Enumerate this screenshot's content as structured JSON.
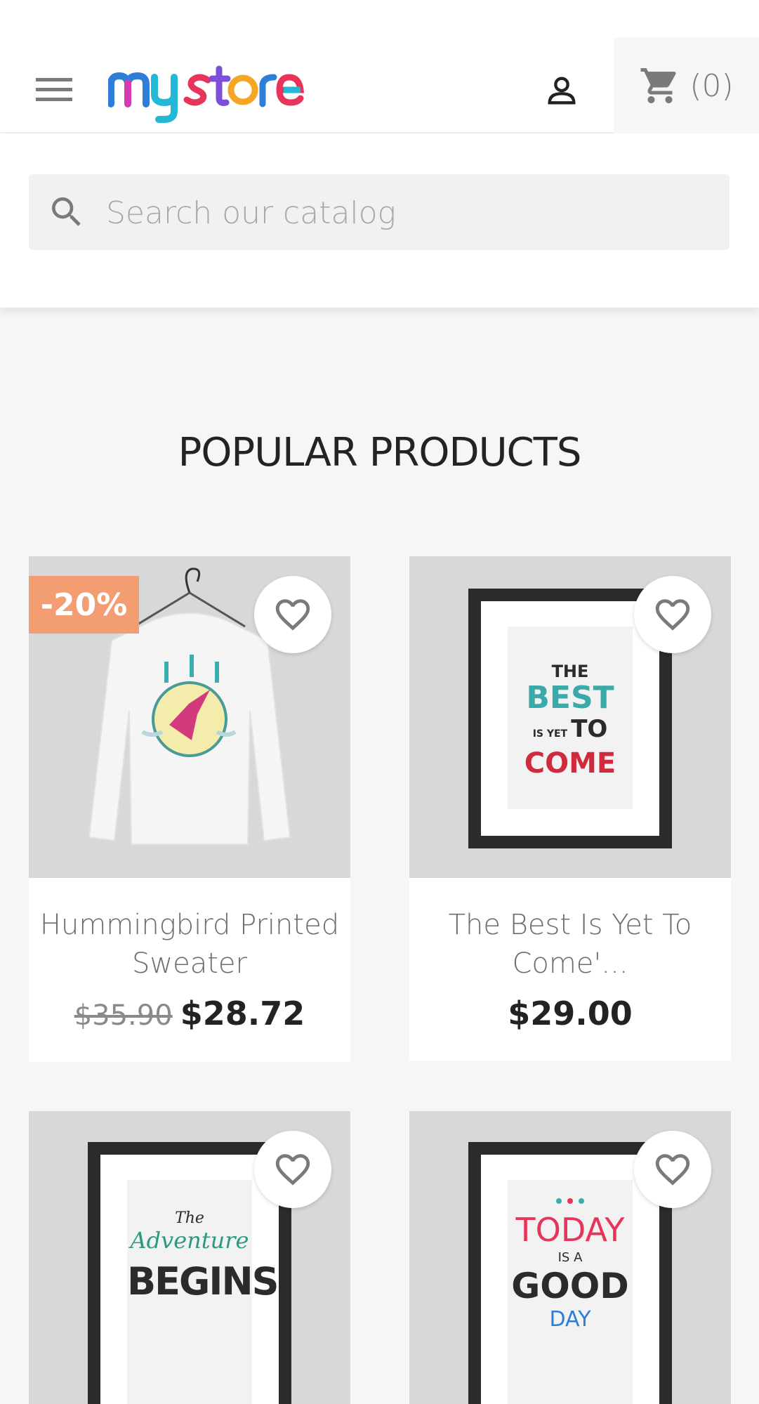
{
  "header": {
    "logo_text": "my store",
    "cart_count": "(0)"
  },
  "search": {
    "placeholder": "Search our catalog"
  },
  "section": {
    "title": "POPULAR PRODUCTS"
  },
  "products": [
    {
      "name": "Hummingbird Printed Sweater",
      "old_price": "$35.90",
      "price": "$28.72",
      "discount": "-20%"
    },
    {
      "name": "The Best Is Yet To Come'...",
      "price": "$29.00",
      "poster_text": [
        "THE",
        "BEST",
        "IS YET",
        "TO",
        "COME"
      ]
    },
    {
      "poster_text": [
        "The",
        "Adventure",
        "BEGINS"
      ]
    },
    {
      "poster_text": [
        "TODAY",
        "IS A",
        "GOOD",
        "DAY"
      ]
    }
  ],
  "colors": {
    "discount_badge": "#f39d72",
    "background": "#f6f6f6",
    "price_text": "#232323"
  },
  "icons": [
    "menu-icon",
    "user-icon",
    "cart-icon",
    "search-icon",
    "heart-icon"
  ]
}
